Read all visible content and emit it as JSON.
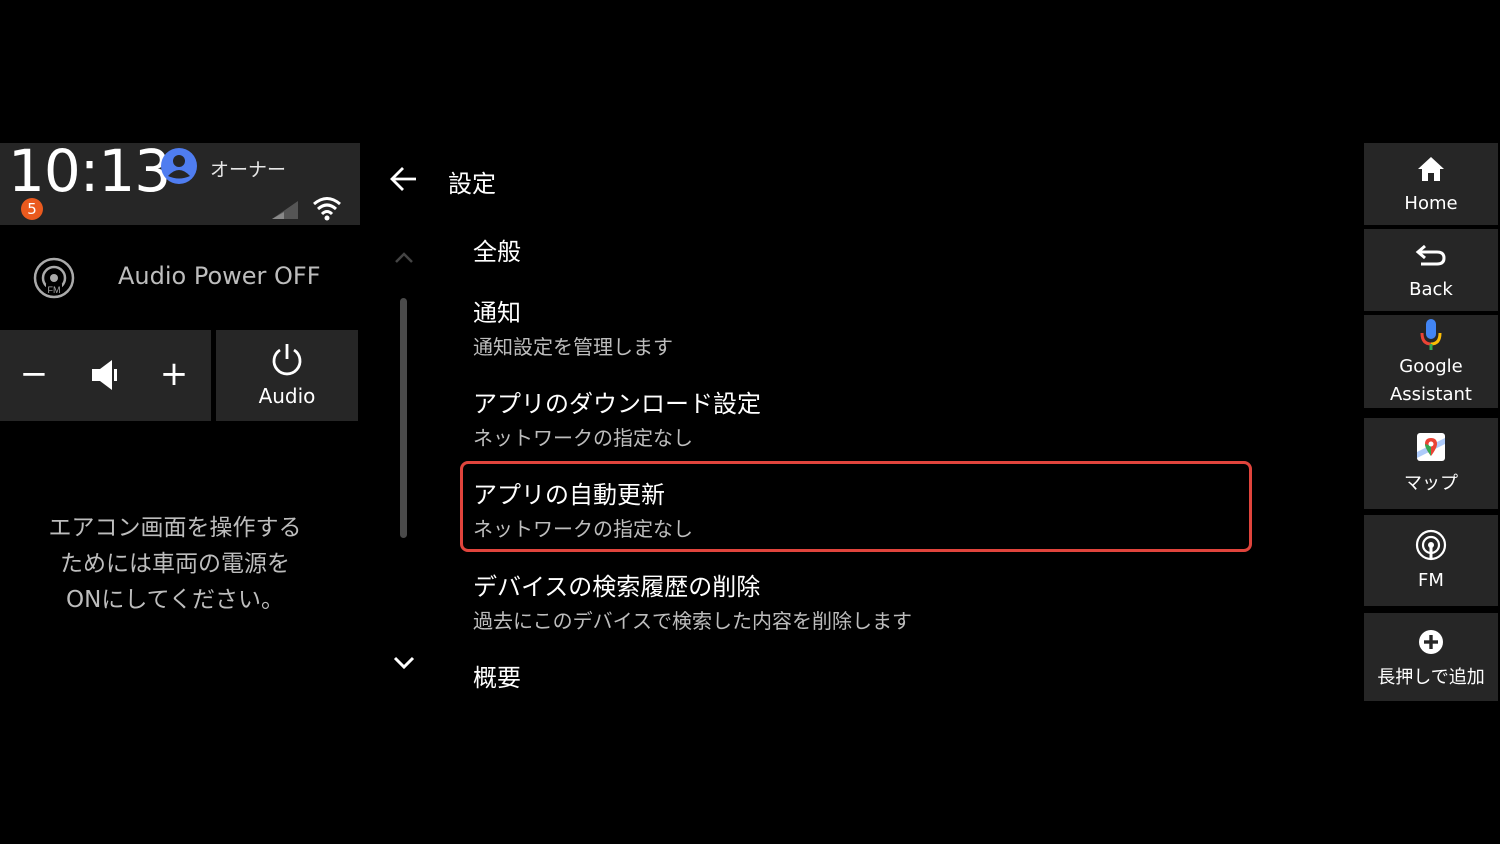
{
  "status_bar": {
    "time": "10:13",
    "notification_count": "5",
    "user_name": "オーナー"
  },
  "audio": {
    "status_text": "Audio Power OFF",
    "volume_minus": "−",
    "volume_plus": "+",
    "audio_button_label": "Audio"
  },
  "climate_note": {
    "lines": [
      "エアコン画面を操作する",
      "ためには車両の電源を",
      "ONにしてください。"
    ]
  },
  "settings": {
    "title": "設定",
    "section_general": "全般",
    "items": [
      {
        "title": "通知",
        "subtitle": "通知設定を管理します"
      },
      {
        "title": "アプリのダウンロード設定",
        "subtitle": "ネットワークの指定なし"
      },
      {
        "title": "アプリの自動更新",
        "subtitle": "ネットワークの指定なし"
      },
      {
        "title": "デバイスの検索履歴の削除",
        "subtitle": "過去にこのデバイスで検索した内容を削除します"
      }
    ],
    "section_about": "概要",
    "selected_index": 2,
    "highlight_color": "#e0443c"
  },
  "dock": {
    "home": "Home",
    "back": "Back",
    "assistant_line1": "Google",
    "assistant_line2": "Assistant",
    "maps": "マップ",
    "fm": "FM",
    "add": "長押しで追加"
  },
  "colors": {
    "background": "#000000",
    "panel": "#262626",
    "badge": "#ea5a1e",
    "avatar": "#4f7df0"
  }
}
